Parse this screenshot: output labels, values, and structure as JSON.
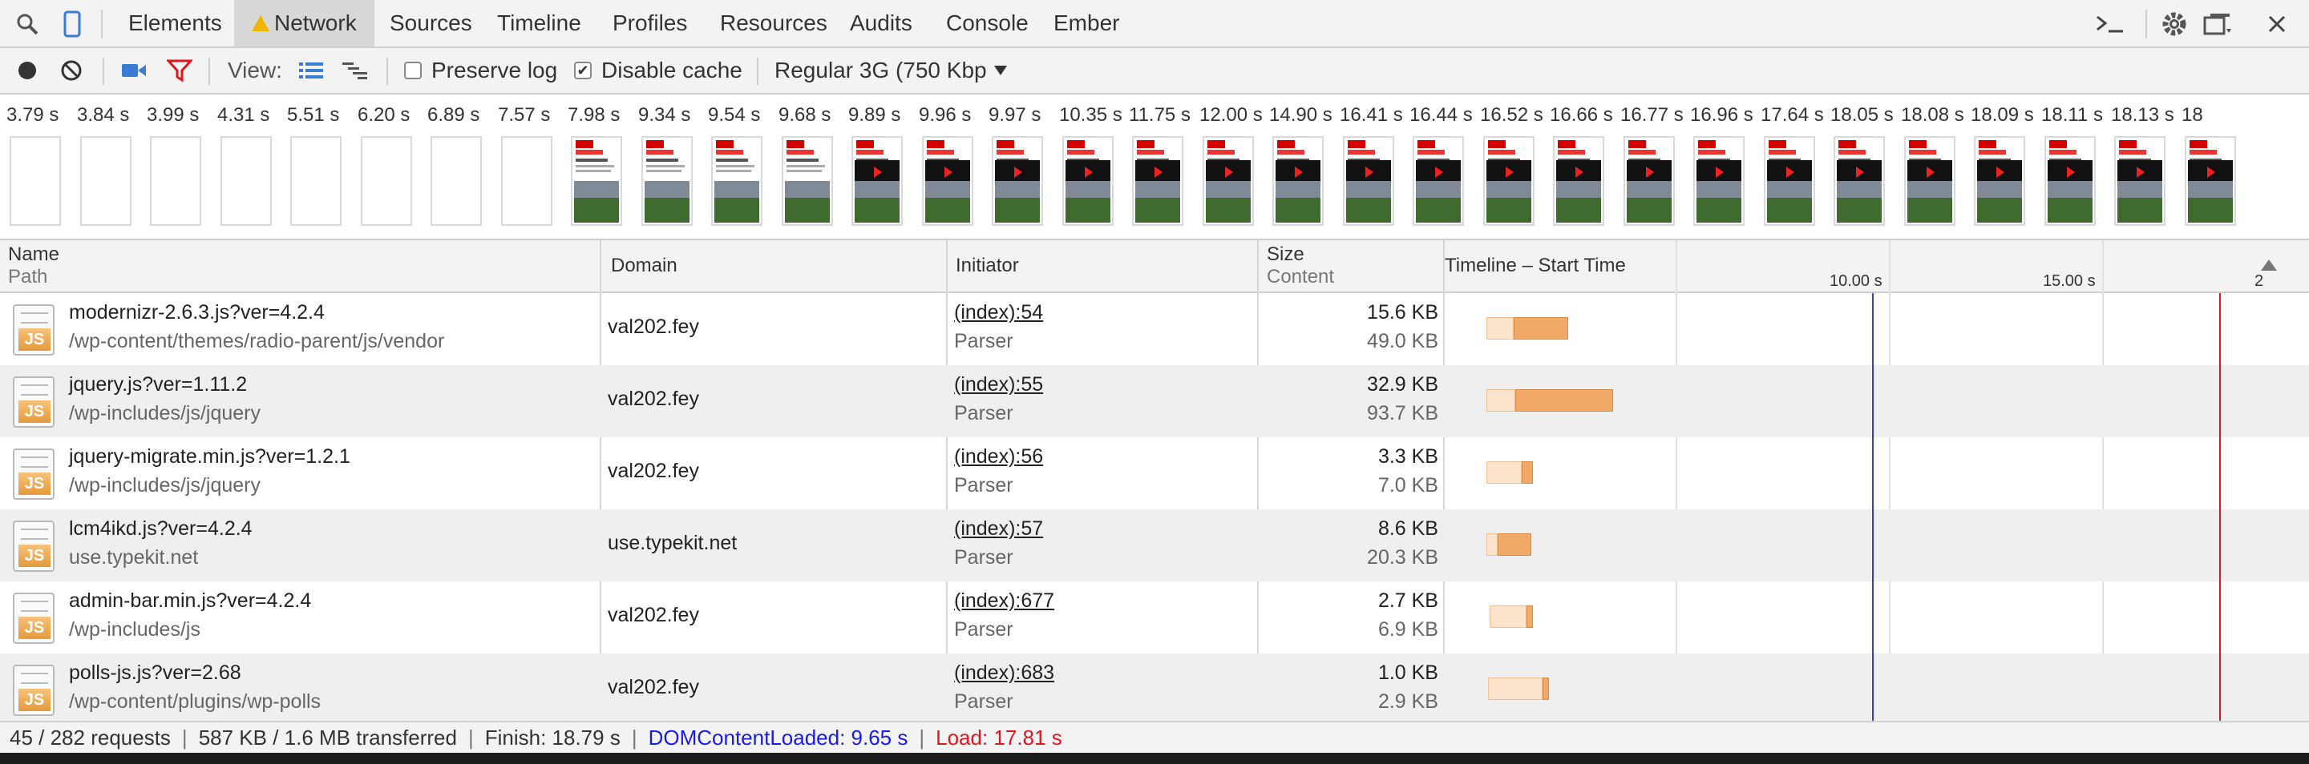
{
  "tabs": [
    {
      "label": "Elements"
    },
    {
      "label": "Network"
    },
    {
      "label": "Sources"
    },
    {
      "label": "Timeline"
    },
    {
      "label": "Profiles"
    },
    {
      "label": "Resources"
    },
    {
      "label": "Audits"
    },
    {
      "label": "Console"
    },
    {
      "label": "Ember"
    }
  ],
  "active_tab": "Network",
  "toolbar": {
    "view_label": "View:",
    "preserve_log_label": "Preserve log",
    "preserve_log_checked": false,
    "disable_cache_label": "Disable cache",
    "disable_cache_checked": true,
    "throttle_value": "Regular 3G (750 Kbp"
  },
  "filmstrip": {
    "times": [
      "3.79 s",
      "3.84 s",
      "3.99 s",
      "4.31 s",
      "5.51 s",
      "6.20 s",
      "6.89 s",
      "7.57 s",
      "7.98 s",
      "9.34 s",
      "9.54 s",
      "9.68 s",
      "9.89 s",
      "9.96 s",
      "9.97 s",
      "10.35 s",
      "11.75 s",
      "12.00 s",
      "14.90 s",
      "16.41 s",
      "16.44 s",
      "16.52 s",
      "16.66 s",
      "16.77 s",
      "16.96 s",
      "17.64 s",
      "18.05 s",
      "18.08 s",
      "18.09 s",
      "18.11 s",
      "18.13 s",
      "18"
    ]
  },
  "columns": {
    "name": "Name",
    "path": "Path",
    "domain": "Domain",
    "initiator": "Initiator",
    "size": "Size",
    "content": "Content",
    "timeline": "Timeline – Start Time"
  },
  "timeline_ticks": [
    "10.00 s",
    "15.00 s",
    "2"
  ],
  "requests": [
    {
      "name": "modernizr-2.6.3.js?ver=4.2.4",
      "path": "/wp-content/themes/radio-parent/js/vendor",
      "domain": "val202.fey",
      "initiator": "(index):54",
      "initiator_type": "Parser",
      "size": "15.6 KB",
      "content": "49.0 KB"
    },
    {
      "name": "jquery.js?ver=1.11.2",
      "path": "/wp-includes/js/jquery",
      "domain": "val202.fey",
      "initiator": "(index):55",
      "initiator_type": "Parser",
      "size": "32.9 KB",
      "content": "93.7 KB"
    },
    {
      "name": "jquery-migrate.min.js?ver=1.2.1",
      "path": "/wp-includes/js/jquery",
      "domain": "val202.fey",
      "initiator": "(index):56",
      "initiator_type": "Parser",
      "size": "3.3 KB",
      "content": "7.0 KB"
    },
    {
      "name": "lcm4ikd.js?ver=4.2.4",
      "path": "use.typekit.net",
      "domain": "use.typekit.net",
      "initiator": "(index):57",
      "initiator_type": "Parser",
      "size": "8.6 KB",
      "content": "20.3 KB"
    },
    {
      "name": "admin-bar.min.js?ver=4.2.4",
      "path": "/wp-includes/js",
      "domain": "val202.fey",
      "initiator": "(index):677",
      "initiator_type": "Parser",
      "size": "2.7 KB",
      "content": "6.9 KB"
    },
    {
      "name": "polls-js.js?ver=2.68",
      "path": "/wp-content/plugins/wp-polls",
      "domain": "val202.fey",
      "initiator": "(index):683",
      "initiator_type": "Parser",
      "size": "1.0 KB",
      "content": "2.9 KB"
    }
  ],
  "status": {
    "requests": "45 / 282 requests",
    "transferred": "587 KB / 1.6 MB transferred",
    "finish": "Finish: 18.79 s",
    "dom_content_loaded": "DOMContentLoaded: 9.65 s",
    "load": "Load: 17.81 s"
  },
  "colors": {
    "dom_line": "#3b3bd9",
    "load_line": "#e0161d",
    "bar_wait": "#fbe3cc",
    "bar_receive": "#f0a966"
  }
}
